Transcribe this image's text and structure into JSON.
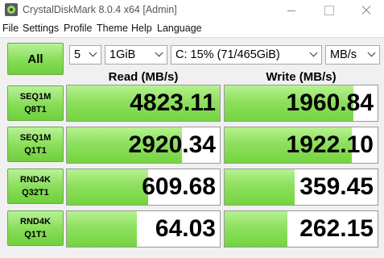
{
  "window": {
    "title": "CrystalDiskMark 8.0.4 x64 [Admin]"
  },
  "menu": [
    "File",
    "Settings",
    "Profile",
    "Theme",
    "Help",
    "Language"
  ],
  "controls": {
    "all_label": "All",
    "test_count": "5",
    "test_size": "1GiB",
    "drive": "C: 15% (71/465GiB)",
    "unit": "MB/s"
  },
  "headers": {
    "read": "Read (MB/s)",
    "write": "Write (MB/s)"
  },
  "tests": [
    {
      "line1": "SEQ1M",
      "line2": "Q8T1",
      "read": "4823.11",
      "write": "1960.84",
      "read_fill": 1.0,
      "write_fill": 0.84
    },
    {
      "line1": "SEQ1M",
      "line2": "Q1T1",
      "read": "2920.34",
      "write": "1922.10",
      "read_fill": 0.75,
      "write_fill": 0.83
    },
    {
      "line1": "RND4K",
      "line2": "Q32T1",
      "read": "609.68",
      "write": "359.45",
      "read_fill": 0.53,
      "write_fill": 0.46
    },
    {
      "line1": "RND4K",
      "line2": "Q1T1",
      "read": "64.03",
      "write": "262.15",
      "read_fill": 0.46,
      "write_fill": 0.41
    }
  ],
  "colors": {
    "accent_green": "#87dd57",
    "cell_bg": "#ffffff",
    "window_bg": "#f0f0f0"
  }
}
